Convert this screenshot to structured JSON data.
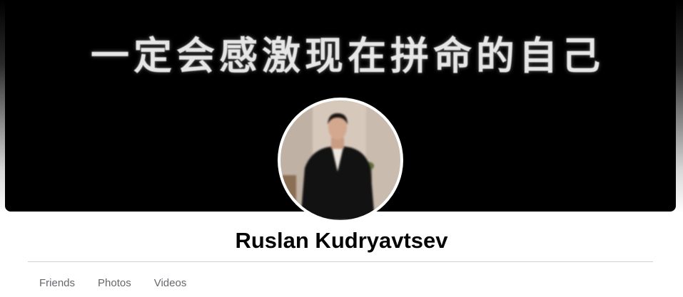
{
  "cover": {
    "text": "一定会感激现在拼命的自己"
  },
  "profile": {
    "name": "Ruslan Kudryavtsev"
  },
  "tabs": [
    {
      "label": "Friends"
    },
    {
      "label": "Photos"
    },
    {
      "label": "Videos"
    }
  ],
  "colors": {
    "cover_background": "#000000",
    "cover_text": "#e6e6e6",
    "name_text": "#050505",
    "tab_text": "#65676b",
    "divider": "#ced0d4"
  }
}
